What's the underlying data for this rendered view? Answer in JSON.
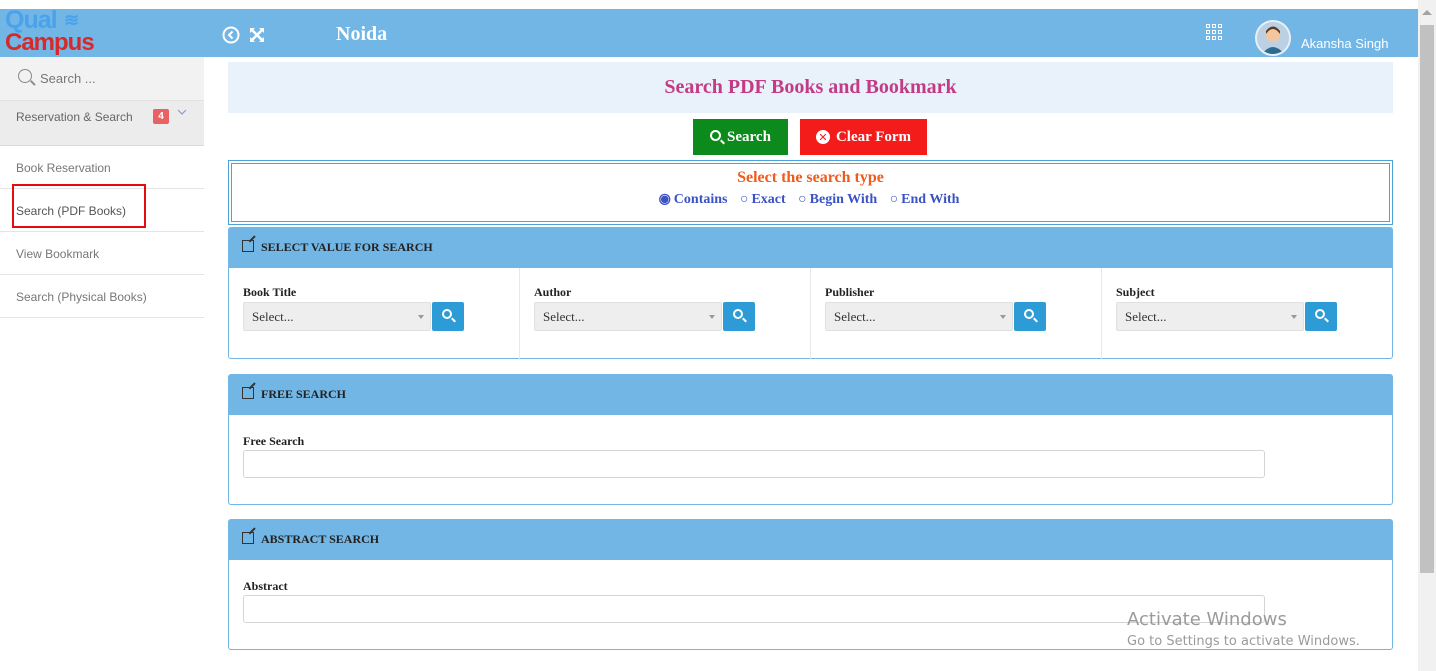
{
  "header": {
    "logo_top": "Qual",
    "logo_bottom": "Campus",
    "campus": "Noida",
    "user_name": "Akansha Singh",
    "icons": [
      "back-circle-icon",
      "expand-icon",
      "apps-grid-icon",
      "user-avatar"
    ]
  },
  "sidebar": {
    "search_placeholder": "Search ...",
    "group": {
      "label": "Reservation & Search",
      "badge": "4"
    },
    "items": [
      {
        "label": "Book Reservation"
      },
      {
        "label": "Search (PDF Books)"
      },
      {
        "label": "View Bookmark"
      },
      {
        "label": "Search (Physical Books)"
      }
    ]
  },
  "main": {
    "title": "Search PDF Books and Bookmark",
    "search_button": "Search",
    "clear_button": "Clear Form",
    "search_type": {
      "heading": "Select the search type",
      "options": [
        "Contains",
        "Exact",
        "Begin With",
        "End With"
      ],
      "selected": "Contains"
    },
    "select_panel": {
      "title": "SELECT VALUE FOR SEARCH",
      "fields": [
        {
          "label": "Book Title",
          "value": "Select..."
        },
        {
          "label": "Author",
          "value": "Select..."
        },
        {
          "label": "Publisher",
          "value": "Select..."
        },
        {
          "label": "Subject",
          "value": "Select..."
        }
      ]
    },
    "free_panel": {
      "title": "FREE SEARCH",
      "label": "Free Search",
      "value": ""
    },
    "abstract_panel": {
      "title": "ABSTRACT SEARCH",
      "label": "Abstract",
      "value": ""
    }
  },
  "watermark": {
    "line1": "Activate Windows",
    "line2": "Go to Settings to activate Windows."
  },
  "colors": {
    "header": "#72b6e5",
    "title_text": "#c33b86",
    "search_button": "#0d8a1c",
    "clear_button": "#f41b1b",
    "search_type_heading": "#f05a1a",
    "radio_text": "#3b52c4",
    "highlight_box": "#e50c0c"
  }
}
